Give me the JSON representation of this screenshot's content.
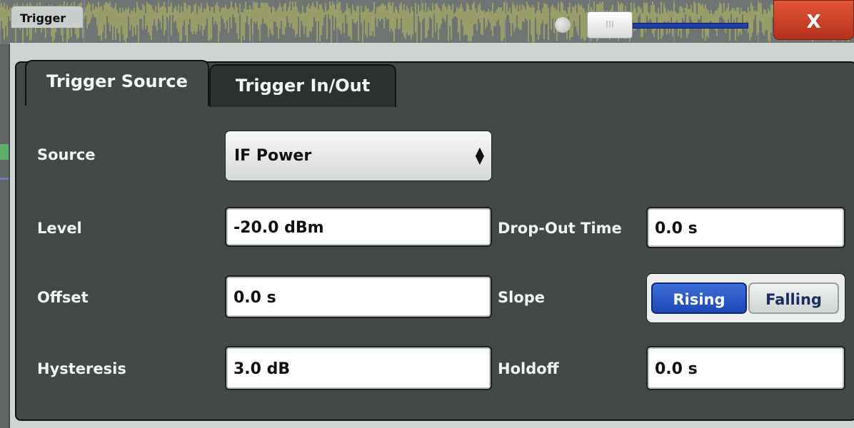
{
  "dialog": {
    "title": "Trigger",
    "close_label": "X"
  },
  "tabs": [
    {
      "label": "Trigger Source",
      "active": true
    },
    {
      "label": "Trigger In/Out",
      "active": false
    }
  ],
  "form": {
    "source": {
      "label": "Source",
      "value": "IF Power"
    },
    "level": {
      "label": "Level",
      "value": "-20.0 dBm"
    },
    "offset": {
      "label": "Offset",
      "value": "0.0 s"
    },
    "hysteresis": {
      "label": "Hysteresis",
      "value": "3.0 dB"
    },
    "dropout": {
      "label": "Drop-Out Time",
      "value": "0.0 s"
    },
    "slope": {
      "label": "Slope",
      "options": [
        "Rising",
        "Falling"
      ],
      "selected": "Rising"
    },
    "holdoff": {
      "label": "Holdoff",
      "value": "0.0 s"
    }
  },
  "colors": {
    "trace": "#d9d85a",
    "rising_active": "#2a57c8",
    "close_button": "#c8402a"
  }
}
